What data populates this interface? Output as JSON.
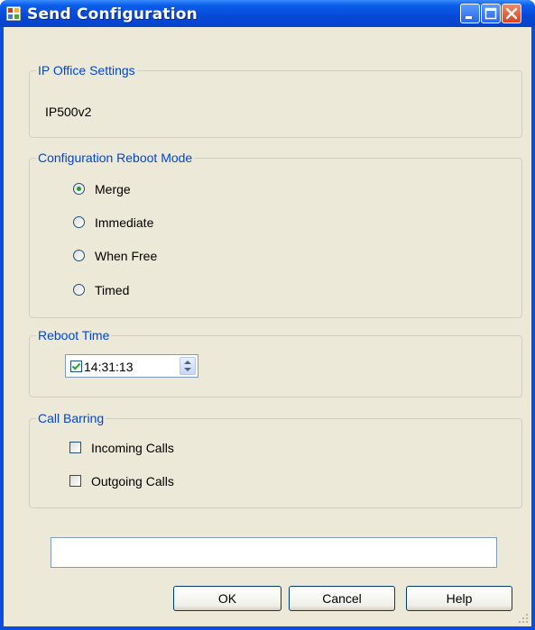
{
  "window": {
    "title": "Send Configuration"
  },
  "ip_office": {
    "legend": "IP Office Settings",
    "system": "IP500v2"
  },
  "reboot_mode": {
    "legend": "Configuration Reboot Mode",
    "options": [
      "Merge",
      "Immediate",
      "When Free",
      "Timed"
    ],
    "selected": "Merge"
  },
  "reboot_time": {
    "legend": "Reboot Time",
    "value": "14:31:13",
    "enabled": true
  },
  "call_barring": {
    "legend": "Call Barring",
    "incoming_label": "Incoming Calls",
    "incoming_checked": false,
    "outgoing_label": "Outgoing Calls",
    "outgoing_checked": false
  },
  "status": {
    "value": ""
  },
  "buttons": {
    "ok": "OK",
    "cancel": "Cancel",
    "help": "Help"
  },
  "icons": [
    "app-icon",
    "minimize-icon",
    "maximize-icon",
    "close-icon",
    "checkmark-icon",
    "spin-up-icon",
    "spin-down-icon",
    "size-grip-icon"
  ],
  "colors": {
    "title_bar": "#0a5ee8",
    "dialog_bg": "#ece9d8",
    "group_legend": "#0046d5",
    "close_button": "#d8431f",
    "radio_selected": "#21a121"
  }
}
